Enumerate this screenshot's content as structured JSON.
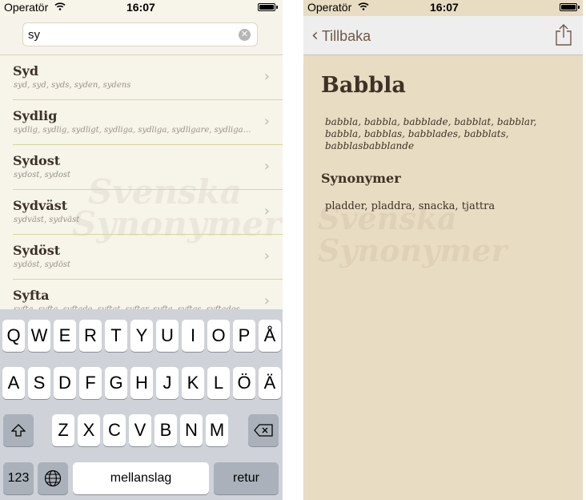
{
  "left": {
    "status": {
      "carrier": "Operatör",
      "time": "16:07",
      "battery_level": 1.0
    },
    "search": {
      "value": "sy"
    },
    "results": [
      {
        "word": "Syd",
        "forms": "syd, syd, syds, syden, sydens"
      },
      {
        "word": "Sydlig",
        "forms": "sydlig, sydlig, sydligt, sydliga, sydliga, sydligare, sydligas..."
      },
      {
        "word": "Sydost",
        "forms": "sydost, sydost"
      },
      {
        "word": "Sydväst",
        "forms": "sydväst, sydväst"
      },
      {
        "word": "Sydöst",
        "forms": "sydöst, sydöst"
      },
      {
        "word": "Syfta",
        "forms": "syfta, syfta, syftade, syftat, syftar, syfta, syftas, syftades..."
      }
    ],
    "keyboard": {
      "row1": [
        "Q",
        "W",
        "E",
        "R",
        "T",
        "Y",
        "U",
        "I",
        "O",
        "P",
        "Å"
      ],
      "row2": [
        "A",
        "S",
        "D",
        "F",
        "G",
        "H",
        "J",
        "K",
        "L",
        "Ö",
        "Ä"
      ],
      "row3": [
        "Z",
        "X",
        "C",
        "V",
        "B",
        "N",
        "M"
      ],
      "numbers_label": "123",
      "space_label": "mellanslag",
      "return_label": "retur",
      "shift_icon": "shift-icon",
      "backspace_icon": "backspace-icon",
      "globe_icon": "globe-icon"
    }
  },
  "right": {
    "status": {
      "carrier": "Operatör",
      "time": "16:07",
      "battery_level": 1.0
    },
    "nav": {
      "back_label": "Tillbaka",
      "share_icon": "share-icon"
    },
    "entry": {
      "title": "Babbla",
      "inflections": "babbla, babbla, babblade, babblat, babblar, babbla, babblas, babblades, babblats, babblasbabblande",
      "synonyms_heading": "Synonymer",
      "synonyms": "pladder, pladdra, snacka, tjattra"
    }
  },
  "colors": {
    "list_divider": "#d8d69a",
    "paper": "#e8dcc2",
    "text_brown": "#3e3125",
    "keyboard_bg": "#cfd2d8"
  }
}
